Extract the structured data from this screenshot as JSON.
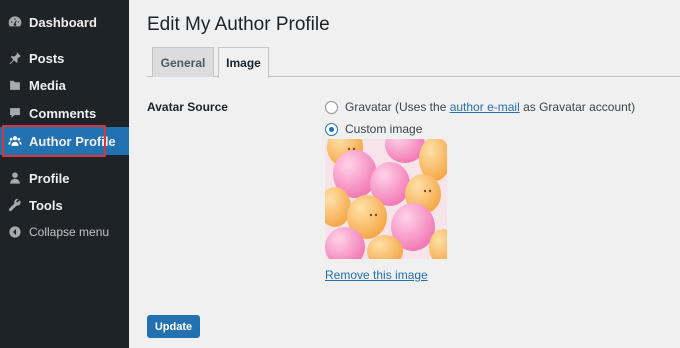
{
  "sidebar": {
    "items": [
      {
        "label": "Dashboard",
        "icon": "dashboard-icon"
      },
      {
        "label": "Posts",
        "icon": "pin-icon"
      },
      {
        "label": "Media",
        "icon": "media-icon"
      },
      {
        "label": "Comments",
        "icon": "comment-icon"
      },
      {
        "label": "Author Profile",
        "icon": "users-icon",
        "active": true
      },
      {
        "label": "Profile",
        "icon": "user-icon"
      },
      {
        "label": "Tools",
        "icon": "wrench-icon"
      },
      {
        "label": "Collapse menu",
        "icon": "collapse-icon"
      }
    ]
  },
  "main": {
    "title": "Edit My Author Profile",
    "tabs": [
      {
        "label": "General",
        "active": false
      },
      {
        "label": "Image",
        "active": true
      }
    ],
    "avatar_source_label": "Avatar Source",
    "options": {
      "gravatar_prefix": "Gravatar (Uses the ",
      "gravatar_link": "author e-mail",
      "gravatar_suffix": " as Gravatar account)",
      "custom_label": "Custom image"
    },
    "remove_link": "Remove this image",
    "update_button": "Update"
  },
  "colors": {
    "sidebar_bg": "#1d2327",
    "accent": "#2271b1",
    "highlight": "#d63638"
  }
}
